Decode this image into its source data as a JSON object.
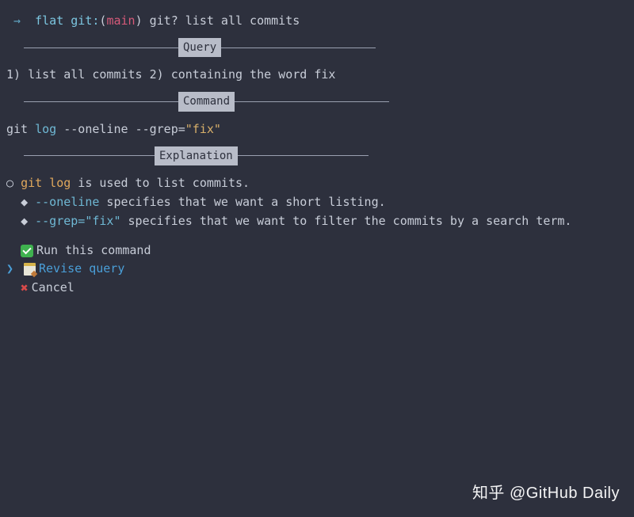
{
  "prompt": {
    "arrow": "→",
    "dir": "flat",
    "git_label": "git:",
    "paren_open": "(",
    "branch": "main",
    "paren_close": ")",
    "command": "git? list all commits"
  },
  "sections": {
    "query_label": " Query ",
    "command_label": " Command ",
    "explanation_label": " Explanation "
  },
  "query_text": "1) list all commits 2) containing the word fix",
  "command_parts": {
    "git": "git",
    "log": "log",
    "flag1": "--oneline",
    "flag2": "--grep=",
    "string": "\"fix\""
  },
  "explanation": {
    "line1_git": "git log",
    "line1_rest": " is used to list commits.",
    "line2_flag": "--oneline",
    "line2_rest": " specifies that we want a short listing.",
    "line3_flag": "--grep=\"fix\"",
    "line3_rest": " specifies that we want to filter the commits by a search term."
  },
  "menu": {
    "run": "Run this command",
    "revise": " Revise query",
    "cancel": "Cancel"
  },
  "watermark": {
    "logo": "知乎",
    "text": "@GitHub Daily"
  }
}
